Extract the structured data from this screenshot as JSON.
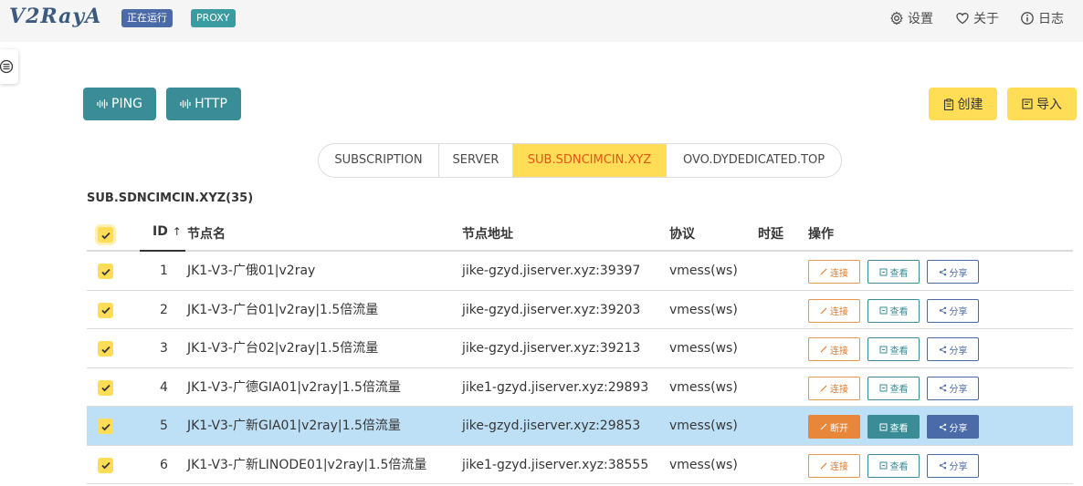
{
  "header": {
    "logo": "V2RayA",
    "status_tag": "正在运行",
    "proxy_tag": "PROXY",
    "nav": {
      "settings": "设置",
      "about": "关于",
      "log": "日志"
    }
  },
  "toolbar": {
    "ping_label": "PING",
    "http_label": "HTTP",
    "create_label": "创建",
    "import_label": "导入"
  },
  "tabs": [
    "SUBSCRIPTION",
    "SERVER",
    "SUB.SDNCIMCIN.XYZ",
    "OVO.DYDEDICATED.TOP"
  ],
  "active_tab": "SUB.SDNCIMCIN.XYZ",
  "group_title": "SUB.SDNCIMCIN.XYZ(35)",
  "table": {
    "columns": {
      "id": "ID",
      "name": "节点名",
      "address": "节点地址",
      "protocol": "协议",
      "latency": "时延",
      "actions": "操作"
    },
    "sort_indicator": "↑",
    "rows": [
      {
        "id": "1",
        "name": "JK1-V3-广俄01|v2ray",
        "address": "jike-gzyd.jiserver.xyz:39397",
        "protocol": "vmess(ws)",
        "latency": "",
        "connect": "连接",
        "view": "查看",
        "share": "分享"
      },
      {
        "id": "2",
        "name": "JK1-V3-广台01|v2ray|1.5倍流量",
        "address": "jike-gzyd.jiserver.xyz:39203",
        "protocol": "vmess(ws)",
        "latency": "",
        "connect": "连接",
        "view": "查看",
        "share": "分享"
      },
      {
        "id": "3",
        "name": "JK1-V3-广台02|v2ray|1.5倍流量",
        "address": "jike-gzyd.jiserver.xyz:39213",
        "protocol": "vmess(ws)",
        "latency": "",
        "connect": "连接",
        "view": "查看",
        "share": "分享"
      },
      {
        "id": "4",
        "name": "JK1-V3-广德GIA01|v2ray|1.5倍流量",
        "address": "jike1-gzyd.jiserver.xyz:29893",
        "protocol": "vmess(ws)",
        "latency": "",
        "connect": "连接",
        "view": "查看",
        "share": "分享"
      },
      {
        "id": "5",
        "name": "JK1-V3-广新GIA01|v2ray|1.5倍流量",
        "address": "jike-gzyd.jiserver.xyz:29853",
        "protocol": "vmess(ws)",
        "latency": "",
        "connect": "断开",
        "view": "查看",
        "share": "分享"
      },
      {
        "id": "6",
        "name": "JK1-V3-广新LINODE01|v2ray|1.5倍流量",
        "address": "jike1-gzyd.jiserver.xyz:38555",
        "protocol": "vmess(ws)",
        "latency": "",
        "connect": "连接",
        "view": "查看",
        "share": "分享"
      }
    ]
  },
  "colors": {
    "teal": "#3a8d96",
    "yellow": "#ffdd57",
    "orange": "#e8863a",
    "blue": "#4b6aa8",
    "selected_row": "#bee0f6"
  }
}
